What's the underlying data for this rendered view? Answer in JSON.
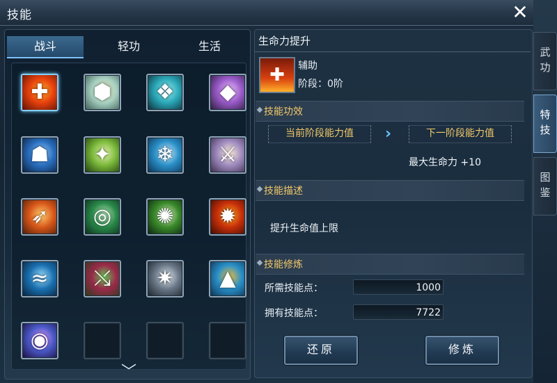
{
  "window": {
    "title": "技能",
    "close_label": "✕"
  },
  "tabs": [
    {
      "label": "战斗",
      "active": true
    },
    {
      "label": "轻功",
      "active": false
    },
    {
      "label": "生活",
      "active": false
    }
  ],
  "side_tabs": [
    {
      "label": [
        "武",
        "功"
      ],
      "active": false
    },
    {
      "label": [
        "特",
        "技"
      ],
      "active": true
    },
    {
      "label": [
        "图",
        "鉴"
      ],
      "active": false
    }
  ],
  "skills": [
    {
      "icon": "vitality-boost-icon",
      "glyph": "✚",
      "colors": [
        "#5a1004",
        "#e8420e",
        "#ffb42a"
      ],
      "selected": true
    },
    {
      "icon": "turtle-shell-icon",
      "glyph": "⬢",
      "colors": [
        "#3a5a52",
        "#a9d2c3",
        "#e8dcb0"
      ]
    },
    {
      "icon": "spirit-wolf-icon",
      "glyph": "❖",
      "colors": [
        "#0c2a35",
        "#2aa8b8",
        "#9ff0f0"
      ]
    },
    {
      "icon": "purple-crystal-icon",
      "glyph": "◆",
      "colors": [
        "#2a1a3a",
        "#9a5bc9",
        "#f0c6ff"
      ]
    },
    {
      "icon": "ghost-aura-icon",
      "glyph": "☗",
      "colors": [
        "#0a1e3a",
        "#2a6fc0",
        "#9fd8ff"
      ]
    },
    {
      "icon": "green-dagger-icon",
      "glyph": "✦",
      "colors": [
        "#1e3a0c",
        "#7ab83a",
        "#e8f7b0"
      ]
    },
    {
      "icon": "ice-wing-icon",
      "glyph": "❄",
      "colors": [
        "#0c3050",
        "#2a90c8",
        "#d8f4ff"
      ]
    },
    {
      "icon": "silver-blade-icon",
      "glyph": "⚔",
      "colors": [
        "#3a2a4a",
        "#a08cc0",
        "#fff2d8"
      ]
    },
    {
      "icon": "flame-spear-icon",
      "glyph": "➶",
      "colors": [
        "#4a1a08",
        "#d8581a",
        "#ffd070"
      ]
    },
    {
      "icon": "green-ring-icon",
      "glyph": "◎",
      "colors": [
        "#0a2a1a",
        "#2a8a4a",
        "#c8f0c8"
      ]
    },
    {
      "icon": "wind-swirl-icon",
      "glyph": "✺",
      "colors": [
        "#0a2010",
        "#3a8a2a",
        "#e8f8d0"
      ]
    },
    {
      "icon": "fire-burst-icon",
      "glyph": "✹",
      "colors": [
        "#3a0a02",
        "#c8300a",
        "#ffb020"
      ]
    },
    {
      "icon": "wave-crash-icon",
      "glyph": "≈",
      "colors": [
        "#06203a",
        "#1a70b0",
        "#9fe0ff"
      ]
    },
    {
      "icon": "crimson-slash-icon",
      "glyph": "⤯",
      "colors": [
        "#2a3a1a",
        "#9a2a4a",
        "#6ac85a"
      ]
    },
    {
      "icon": "stone-strike-icon",
      "glyph": "✷",
      "colors": [
        "#1a2028",
        "#6a7888",
        "#e8eef4"
      ]
    },
    {
      "icon": "golden-mountain-icon",
      "glyph": "▲",
      "colors": [
        "#0a3050",
        "#2a90c8",
        "#f0c040"
      ]
    },
    {
      "icon": "blue-vortex-icon",
      "glyph": "◉",
      "colors": [
        "#1a0a3a",
        "#4a5ac8",
        "#e8a0ff"
      ]
    },
    {
      "icon": "empty-slot",
      "glyph": "",
      "colors": []
    },
    {
      "icon": "empty-slot",
      "glyph": "",
      "colors": []
    },
    {
      "icon": "empty-slot",
      "glyph": "",
      "colors": []
    }
  ],
  "detail": {
    "title": "生命力提升",
    "type": "辅助",
    "stage": "阶段：0阶",
    "effect_header": "技能功效",
    "current_label": "当前阶段能力值",
    "next_label": "下一阶段能力值",
    "next_value": "最大生命力 +10",
    "desc_header": "技能描述",
    "description": "提升生命值上限",
    "train_header": "技能修炼",
    "required_label": "所需技能点：",
    "required_value": "1000",
    "owned_label": "拥有技能点：",
    "owned_value": "7722",
    "reset_button": "还原",
    "train_button": "修炼"
  },
  "colors": {
    "accent": "#7fd1ff",
    "section_text": "#f2c86a"
  }
}
